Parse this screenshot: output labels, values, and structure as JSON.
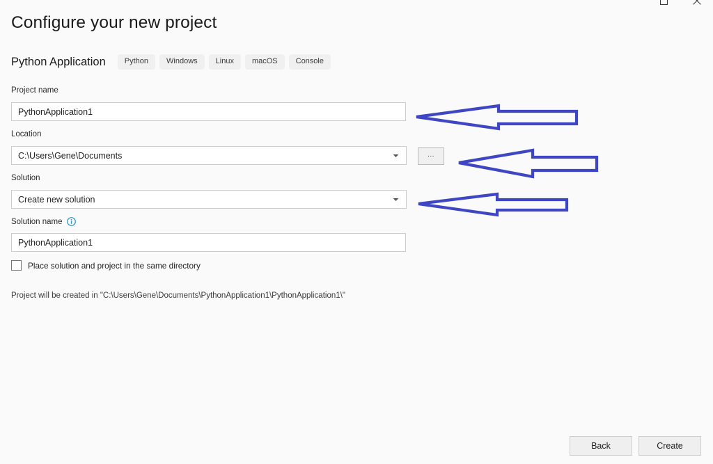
{
  "window": {
    "controls": [
      {
        "name": "maximize",
        "glyph": "□"
      },
      {
        "name": "close",
        "glyph": "✕"
      }
    ]
  },
  "header": {
    "title": "Configure your new project",
    "template_name": "Python Application",
    "tags": [
      "Python",
      "Windows",
      "Linux",
      "macOS",
      "Console"
    ]
  },
  "form": {
    "project_name": {
      "label": "Project name",
      "value": "PythonApplication1"
    },
    "location": {
      "label": "Location",
      "value": "C:\\Users\\Gene\\Documents",
      "browse_label": "..."
    },
    "solution": {
      "label": "Solution",
      "value": "Create new solution"
    },
    "solution_name": {
      "label": "Solution name",
      "value": "PythonApplication1",
      "info_icon": "info-icon"
    },
    "same_directory_checkbox": {
      "label": "Place solution and project in the same directory",
      "checked": false
    },
    "caption": "Project will be created in \"C:\\Users\\Gene\\Documents\\PythonApplication1\\PythonApplication1\\\""
  },
  "footer": {
    "back_label": "Back",
    "create_label": "Create"
  },
  "annotations": {
    "color": "#3f46c4",
    "arrows": [
      {
        "name": "arrow-to-project-name",
        "target": "project-name-field"
      },
      {
        "name": "arrow-to-browse-button",
        "target": "location-browse-button"
      },
      {
        "name": "arrow-to-solution-dropdown",
        "target": "solution-dropdown"
      }
    ]
  },
  "colors": {
    "background": "#fafafa",
    "accent": "#3f46c4",
    "info_blue": "#2b93c4",
    "tag_background": "#f0f0f0",
    "field_border": "#cccccc"
  }
}
